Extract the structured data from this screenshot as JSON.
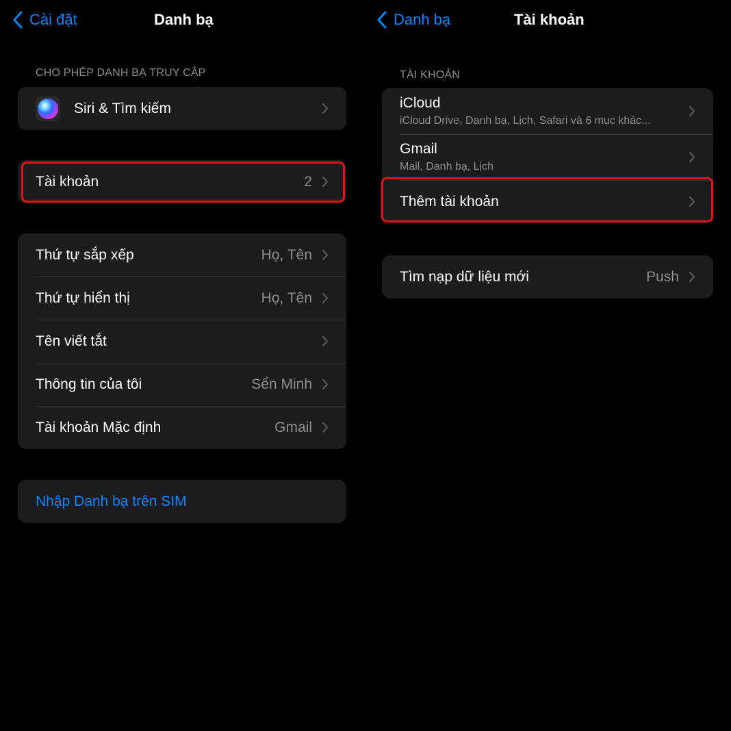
{
  "left": {
    "nav": {
      "back_label": "Cài đặt",
      "title": "Danh bạ"
    },
    "allow_access": {
      "header": "CHO PHÉP DANH BẠ TRUY CẬP",
      "siri_label": "Siri & Tìm kiếm"
    },
    "accounts_row": {
      "label": "Tài khoản",
      "value": "2"
    },
    "settings": [
      {
        "label": "Thứ tự sắp xếp",
        "value": "Họ, Tên"
      },
      {
        "label": "Thứ tự hiển thị",
        "value": "Họ, Tên"
      },
      {
        "label": "Tên viết tắt",
        "value": ""
      },
      {
        "label": "Thông tin của tôi",
        "value": "Sển Minh"
      },
      {
        "label": "Tài khoản Mặc định",
        "value": "Gmail"
      }
    ],
    "import_sim_label": "Nhập Danh bạ trên SIM"
  },
  "right": {
    "nav": {
      "back_label": "Danh bạ",
      "title": "Tài khoản"
    },
    "accounts_header": "TÀI KHOẢN",
    "accounts": [
      {
        "name": "iCloud",
        "detail": "iCloud Drive, Danh bạ, Lịch, Safari và 6 mục khác..."
      },
      {
        "name": "Gmail",
        "detail": "Mail, Danh bạ, Lịch"
      }
    ],
    "add_account_label": "Thêm tài khoản",
    "fetch_row": {
      "label": "Tìm nạp dữ liệu mới",
      "value": "Push"
    }
  },
  "colors": {
    "accent": "#0a84ff",
    "highlight": "#e1141b",
    "cell": "#1c1c1e",
    "background": "#000000"
  },
  "icons": {
    "back": "chevron-left-icon",
    "disclosure": "chevron-right-icon",
    "siri": "siri-icon"
  }
}
